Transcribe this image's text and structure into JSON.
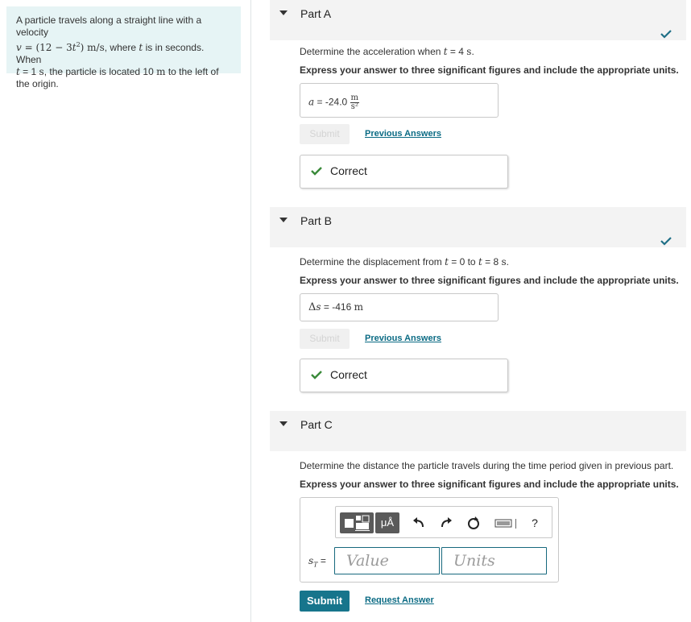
{
  "problem": {
    "text1": "A particle travels along a straight line with a velocity",
    "v_sym": "v",
    "v_eq": " = (12 − 3",
    "t_sym": "t",
    "sup2": "2",
    "v_units": ") m/s",
    "text2": ", where ",
    "t_sym2": "t",
    "text3": " is in seconds. When",
    "t_sym3": "t",
    "text4": " = 1 ",
    "s_unit": "s",
    "text5": ", the particle is located 10 ",
    "m_unit": "m",
    "text6": " to the left of the origin."
  },
  "partA": {
    "title": "Part A",
    "q_pre": "Determine the acceleration when ",
    "q_t": "t",
    "q_eq": " = 4 ",
    "q_unit": "s",
    "q_end": ".",
    "instruction": "Express your answer to three significant figures and include the appropriate units.",
    "ans_sym": "a",
    "ans_eq": " = ",
    "ans_val": "-24.0",
    "unit_num": "m",
    "unit_den": "s²",
    "submit": "Submit",
    "link": "Previous Answers",
    "feedback": "Correct"
  },
  "partB": {
    "title": "Part B",
    "q_pre": "Determine the displacement from ",
    "q_t1": "t",
    "q_mid": " = 0 to ",
    "q_t2": "t",
    "q_eq": " = 8 ",
    "q_unit": "s",
    "q_end": ".",
    "instruction": "Express your answer to three significant figures and include the appropriate units.",
    "ans_delta": "Δ",
    "ans_sym": "s",
    "ans_eq": " = ",
    "ans_val": "-416 ",
    "ans_unit": "m",
    "submit": "Submit",
    "link": "Previous Answers",
    "feedback": "Correct"
  },
  "partC": {
    "title": "Part C",
    "question": "Determine the distance the particle travels during the time period given in previous part.",
    "instruction": "Express your answer to three significant figures and include the appropriate units.",
    "ans_sym": "s",
    "ans_sub": "T",
    "ans_eq": " = ",
    "mu_label": "μÅ",
    "help": "?",
    "value_placeholder": "Value",
    "units_placeholder": "Units",
    "submit": "Submit",
    "link": "Request Answer"
  },
  "colors": {
    "accent": "#17758c",
    "check": "#3a8a3a",
    "link": "#0b6b84",
    "problem_bg": "#e6f4f5"
  },
  "icons": [
    "templates-icon",
    "undo-icon",
    "redo-icon",
    "reset-icon",
    "keyboard-icon",
    "help-icon",
    "checkmark-icon",
    "caret-down-icon"
  ]
}
